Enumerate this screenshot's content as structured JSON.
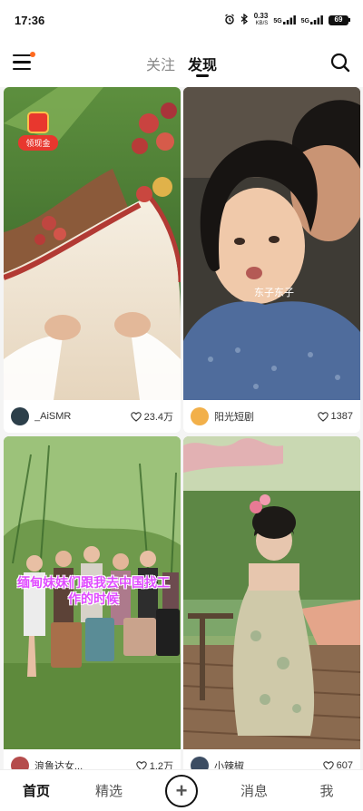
{
  "status_bar": {
    "time": "17:36",
    "net_speed_value": "0.33",
    "net_speed_unit": "KB/S",
    "signal_1": "5G",
    "signal_2": "5G",
    "battery": "69"
  },
  "top_nav": {
    "tabs": [
      {
        "label": "关注",
        "active": false
      },
      {
        "label": "发现",
        "active": true
      }
    ]
  },
  "feed": {
    "cards": [
      {
        "author": "_AiSMR",
        "likes": "23.4万",
        "badge": "领现金",
        "overlay": ""
      },
      {
        "author": "阳光短剧",
        "likes": "1387",
        "overlay": "东子东子"
      },
      {
        "author": "浪鲁达女...",
        "likes": "1.2万",
        "caption": "缅甸妹妹们跟我去中国找工作的时候"
      },
      {
        "author": "小辣椒",
        "likes": "607"
      }
    ]
  },
  "bottom_nav": {
    "items": [
      {
        "label": "首页",
        "active": true
      },
      {
        "label": "精选",
        "active": false
      },
      {
        "label": "+",
        "active": false
      },
      {
        "label": "消息",
        "active": false
      },
      {
        "label": "我",
        "active": false
      }
    ]
  },
  "colors": {
    "accent": "#ff6a1f",
    "red_packet": "#e8372e",
    "caption_purple": "#e04bff"
  }
}
